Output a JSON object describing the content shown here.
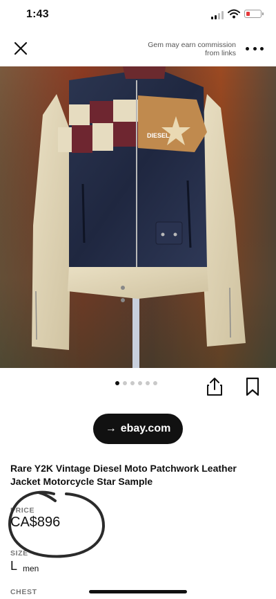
{
  "status_bar": {
    "time": "1:43"
  },
  "header": {
    "disclaimer": "Gem may earn commission from links"
  },
  "photo": {
    "brand_print": "DIESEL"
  },
  "carousel": {
    "image_count": 6,
    "active_index": 0
  },
  "source": {
    "label": "ebay.com",
    "arrow": "→"
  },
  "product": {
    "title": "Rare Y2K Vintage Diesel Moto Patchwork Leather Jacket Motorcycle Star Sample",
    "price_label": "PRICE",
    "price": "CA$896",
    "size_label": "SIZE",
    "size": "L",
    "size_gender": "men",
    "chest_label": "CHEST"
  },
  "icons": {
    "close": "close-icon",
    "more": "more-icon",
    "share": "share-icon",
    "save": "bookmark-icon"
  },
  "colors": {
    "button_bg": "#111111",
    "markup_stroke": "#2b2b2b",
    "battery_low": "#e5383b"
  }
}
